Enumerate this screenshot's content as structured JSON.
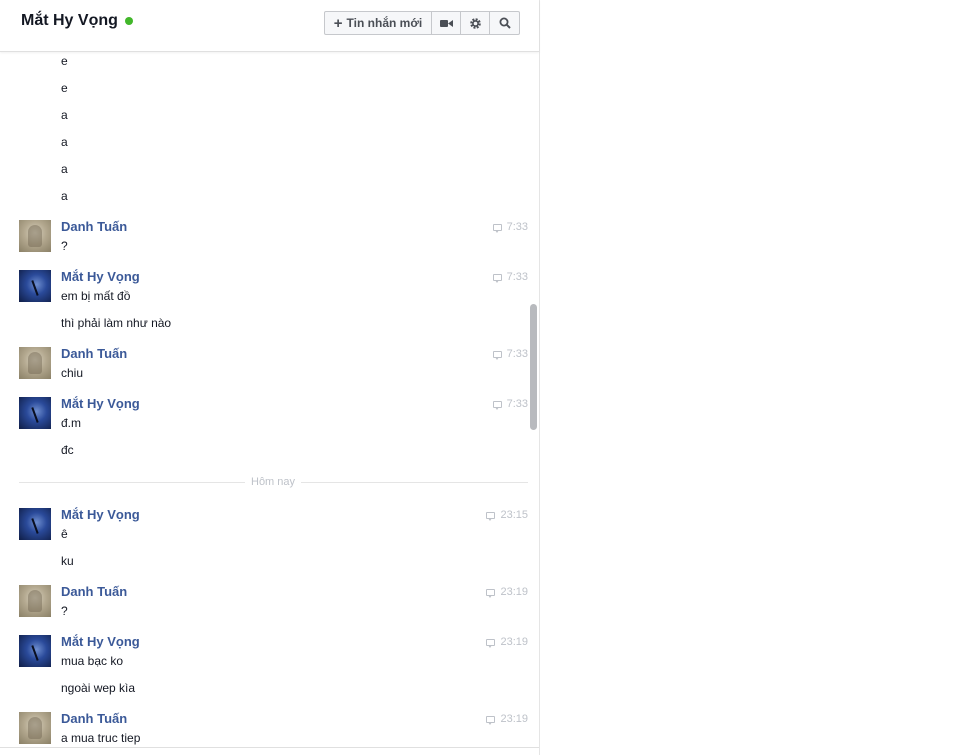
{
  "header": {
    "title": "Mắt Hy Vọng",
    "online_color": "#42b72a",
    "new_message_label": "Tin nhắn mới",
    "icons": [
      "plus-icon",
      "video-icon",
      "gear-icon",
      "search-icon"
    ]
  },
  "messages": {
    "early": [
      "e",
      "e",
      "a",
      "a",
      "a",
      "a"
    ],
    "group1": {
      "sender": "Danh Tuấn",
      "time": "7:33",
      "lines": [
        "?"
      ]
    },
    "group2": {
      "sender": "Mắt Hy Vọng",
      "time": "7:33",
      "lines": [
        "em bị mất đồ",
        "thì phải làm như nào"
      ]
    },
    "group3": {
      "sender": "Danh Tuấn",
      "time": "7:33",
      "lines": [
        "chiu"
      ]
    },
    "group4": {
      "sender": "Mắt Hy Vọng",
      "time": "7:33",
      "lines": [
        "đ.m",
        "đc"
      ]
    },
    "divider": "Hôm nay",
    "group5": {
      "sender": "Mắt Hy Vọng",
      "time": "23:15",
      "lines": [
        "ê",
        "ku"
      ]
    },
    "group6": {
      "sender": "Danh Tuấn",
      "time": "23:19",
      "lines": [
        "?"
      ]
    },
    "group7": {
      "sender": "Mắt Hy Vọng",
      "time": "23:19",
      "lines": [
        "mua bạc ko",
        "ngoài wep kìa"
      ]
    },
    "group8": {
      "sender": "Danh Tuấn",
      "time": "23:19",
      "lines": [
        "a mua truc tiep"
      ]
    }
  },
  "colors": {
    "sender": "#3b5998",
    "timestamp": "#bec2c9",
    "text": "#141823"
  }
}
